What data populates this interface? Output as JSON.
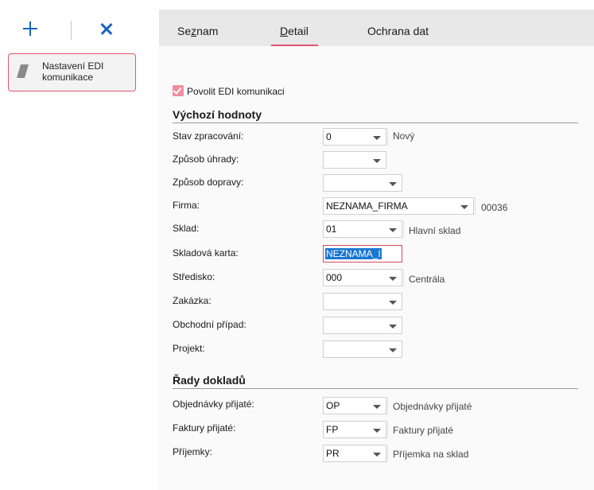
{
  "toolbar": {
    "add_icon": "plus-icon",
    "delete_icon": "close-icon"
  },
  "nav": {
    "item_label": "Nastavení EDI komunikace",
    "item_icon": "document-icon"
  },
  "tabs": [
    {
      "pre": "Se",
      "ul": "z",
      "post": "nam"
    },
    {
      "pre": "",
      "ul": "D",
      "post": "etail"
    },
    {
      "pre": "",
      "ul": "",
      "post": "Ochrana dat"
    }
  ],
  "active_tab": "Detail",
  "enable_edi": {
    "label": "Povolit EDI komunikaci",
    "checked": true
  },
  "defaults": {
    "title": "Výchozí hodnoty",
    "rows": [
      {
        "label": "Stav zpracování:",
        "value": "0",
        "desc": "Nový"
      },
      {
        "label": "Způsob úhrady:",
        "value": "",
        "desc": ""
      },
      {
        "label": "Způsob dopravy:",
        "value": "",
        "desc": ""
      },
      {
        "label": "Firma:",
        "value": "NEZNAMA_FIRMA",
        "desc": "00036"
      },
      {
        "label": "Sklad:",
        "value": "01",
        "desc": "Hlavní sklad"
      },
      {
        "label": "Skladová karta:",
        "value": "NEZNAMA_I",
        "desc": ""
      },
      {
        "label": "Středisko:",
        "value": "000",
        "desc": "Centrála"
      },
      {
        "label": "Zakázka:",
        "value": "",
        "desc": ""
      },
      {
        "label": "Obchodní případ:",
        "value": "",
        "desc": ""
      },
      {
        "label": "Projekt:",
        "value": "",
        "desc": ""
      }
    ]
  },
  "series": {
    "title": "Řady dokladů",
    "rows": [
      {
        "label": "Objednávky přijaté:",
        "value": "OP",
        "desc": "Objednávky přijaté"
      },
      {
        "label": "Faktury přijaté:",
        "value": "FP",
        "desc": "Faktury přijaté"
      },
      {
        "label": "Příjemky:",
        "value": "PR",
        "desc": "Příjemka na sklad"
      }
    ]
  },
  "colors": {
    "accent": "#e0566e",
    "brand_blue": "#1565c0",
    "checkbox": "#f08ea0",
    "selection": "#1976d2"
  }
}
